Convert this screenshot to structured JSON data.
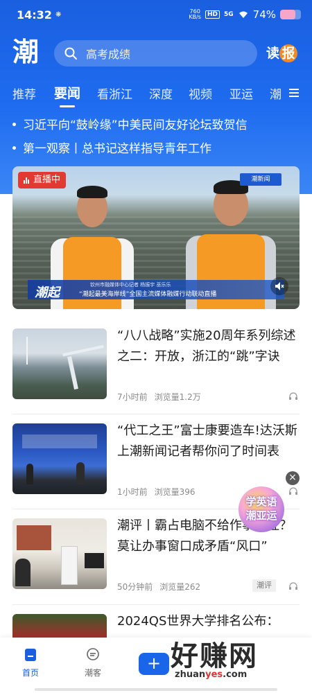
{
  "status_bar": {
    "time": "14:32",
    "net_speed_value": "760",
    "net_speed_unit": "KB/s",
    "hd": "HD",
    "signal": "5G",
    "battery": "74%",
    "battery_level": 0.74
  },
  "header": {
    "logo": "潮",
    "search_placeholder": "高考成绩",
    "read_label": "读",
    "read_circle": "报"
  },
  "tabs": [
    {
      "label": "推荐"
    },
    {
      "label": "要闻"
    },
    {
      "label": "看浙江"
    },
    {
      "label": "深度"
    },
    {
      "label": "视频"
    },
    {
      "label": "亚运"
    },
    {
      "label": "潮"
    }
  ],
  "active_tab": "要闻",
  "headlines": [
    {
      "text": "习近平向“鼓岭缘”中美民间友好论坛致贺信"
    },
    {
      "text": "第一观察丨总书记这样指导青年工作"
    }
  ],
  "live": {
    "badge": "直播中",
    "channel": "潮新闻",
    "caption_top": "钦州市融媒体中心记者 杨振宇 巫乐乐",
    "caption_main": "“潮起最美海岸线”全国主流媒体融媒行动联动直播",
    "brand": "潮起"
  },
  "news": [
    {
      "title": "“八八战略”实施20周年系列综述之二：开放，浙江的“跳”字诀",
      "time": "7小时前",
      "views": "浏览量1.2万",
      "tag": ""
    },
    {
      "title": "“代工之王”富士康要造车!达沃斯上潮新闻记者帮你问了时间表",
      "time": "1小时前",
      "views": "浏览量396",
      "tag": ""
    },
    {
      "title": "潮评丨霸占电脑不给作事办证？莫让办事窗口成矛盾“风口”",
      "time": "50分钟前",
      "views": "浏览量262",
      "tag": "潮评"
    },
    {
      "title": "2024QS世界大学排名公布：",
      "time": "",
      "views": "",
      "tag": ""
    }
  ],
  "float_ad": {
    "line1": "学英语",
    "line2": "潮亚运"
  },
  "bottom_nav": {
    "home": "首页",
    "chao_ke": "潮客",
    "plus": "+"
  },
  "watermark": {
    "big": "好赚网",
    "small_a": "zhuan",
    "small_b": "yes",
    "small_c": ".com"
  },
  "colors": {
    "brand_blue": "#1a5fe0",
    "live_red": "#e23a32",
    "accent_orange": "#f08a24"
  }
}
